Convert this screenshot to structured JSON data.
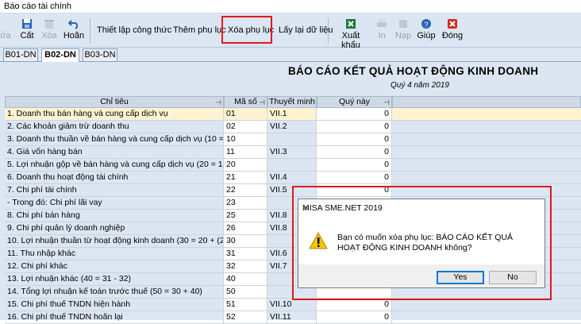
{
  "window": {
    "title": "Báo cáo tài chính"
  },
  "toolbar": {
    "undo_partial": "ửa",
    "save": "Cất",
    "delete": "Xóa",
    "revert": "Hoãn",
    "setup_formula": "Thiết lập công thức",
    "add_appendix": "Thêm phụ lục",
    "delete_appendix": "Xóa phụ lục",
    "reload_data": "Lấy lại dữ liệu",
    "export": "Xuất khẩu",
    "print": "In",
    "load": "Nạp",
    "help": "Giúp",
    "close": "Đóng"
  },
  "tabs": [
    "B01-DN",
    "B02-DN",
    "B03-DN"
  ],
  "report": {
    "title": "BÁO CÁO KẾT QUẢ HOẠT ĐỘNG KINH DOANH",
    "period": "Quý 4 năm 2019"
  },
  "columns": [
    "Chỉ tiêu",
    "Mã số",
    "Thuyết minh",
    "Quý này"
  ],
  "rows": [
    {
      "name": "1. Doanh thu bán hàng và cung cấp dịch vụ",
      "code": "01",
      "note": "VII.1",
      "value": "0"
    },
    {
      "name": "2. Các khoản giảm trừ doanh thu",
      "code": "02",
      "note": "VII.2",
      "value": "0"
    },
    {
      "name": "3. Doanh thu thuần về bán hàng và cung cấp dịch vụ (10 = 01 - 02)",
      "code": "10",
      "note": "",
      "value": "0"
    },
    {
      "name": "4. Giá vốn hàng bán",
      "code": "11",
      "note": "VII.3",
      "value": "0"
    },
    {
      "name": "5. Lợi nhuận gộp về bán hàng và cung cấp dịch vụ (20 = 10 - 11)",
      "code": "20",
      "note": "",
      "value": "0"
    },
    {
      "name": "6. Doanh thu hoạt động tài chính",
      "code": "21",
      "note": "VII.4",
      "value": "0"
    },
    {
      "name": "7. Chi phí tài chính",
      "code": "22",
      "note": "VII.5",
      "value": "0"
    },
    {
      "name": "- Trong đó: Chi phí lãi vay",
      "code": "23",
      "note": "",
      "value": ""
    },
    {
      "name": "8. Chi phí bán hàng",
      "code": "25",
      "note": "VII.8",
      "value": ""
    },
    {
      "name": "9. Chi phí quản lý doanh nghiệp",
      "code": "26",
      "note": "VII.8",
      "value": ""
    },
    {
      "name": "10. Lợi nhuận thuần từ hoạt động kinh doanh (30 = 20 + (21 -22) - (25 + 26))",
      "code": "30",
      "note": "",
      "value": ""
    },
    {
      "name": "11. Thu nhập khác",
      "code": "31",
      "note": "VII.6",
      "value": ""
    },
    {
      "name": "12. Chi phí khác",
      "code": "32",
      "note": "VII.7",
      "value": ""
    },
    {
      "name": "13. Lợi nhuận khác (40 = 31 - 32)",
      "code": "40",
      "note": "",
      "value": ""
    },
    {
      "name": "14. Tổng lợi nhuận kế toán trước thuế (50 = 30 + 40)",
      "code": "50",
      "note": "",
      "value": ""
    },
    {
      "name": "15. Chi phí thuế TNDN hiện hành",
      "code": "51",
      "note": "VII.10",
      "value": "0"
    },
    {
      "name": "16. Chi phí thuế TNDN hoãn lại",
      "code": "52",
      "note": "VII.11",
      "value": "0"
    }
  ],
  "dialog": {
    "title": "MISA SME.NET 2019",
    "message": "Bạn có muốn xóa phụ lục: BÁO CÁO KẾT QUẢ HOẠT ĐỘNG KINH DOANH không?",
    "yes": "Yes",
    "no": "No"
  },
  "colors": {
    "accent_red": "#e0191d",
    "toolbar_bg": "#dbe6f2",
    "selected_row": "#fdf3d2"
  }
}
